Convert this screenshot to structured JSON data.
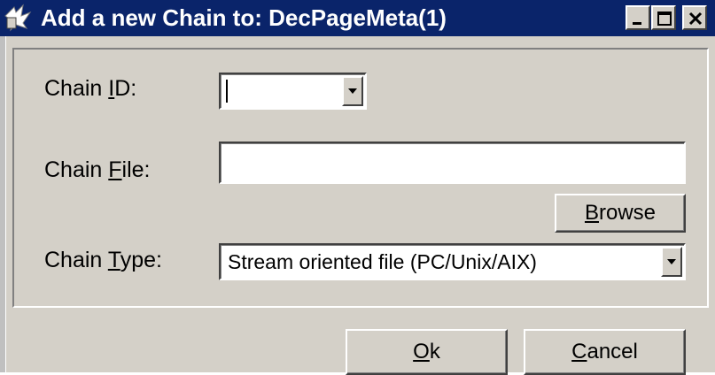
{
  "window": {
    "title": "Add a new Chain to: DecPageMeta(1)",
    "controls": {
      "minimize": "minimize-icon",
      "maximize": "maximize-icon",
      "close": "close-icon"
    }
  },
  "form": {
    "chain_id": {
      "label_pre": "Chain ",
      "label_key": "I",
      "label_post": "D:",
      "value": ""
    },
    "chain_file": {
      "label_pre": "Chain ",
      "label_key": "F",
      "label_post": "ile:",
      "value": ""
    },
    "browse_button": {
      "key": "B",
      "rest": "rowse"
    },
    "chain_type": {
      "label_pre": "Chain ",
      "label_key": "T",
      "label_post": "ype:",
      "selected": "Stream oriented file (PC/Unix/AIX)"
    }
  },
  "buttons": {
    "ok": {
      "key": "O",
      "rest": "k"
    },
    "cancel": {
      "key": "C",
      "rest": "ancel"
    }
  },
  "colors": {
    "title_bar": "#0a246a",
    "face": "#d4d0c8",
    "field": "#ffffff"
  }
}
